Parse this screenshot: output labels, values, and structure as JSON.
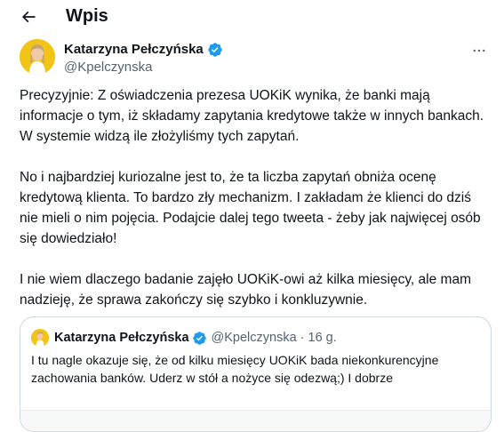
{
  "header": {
    "title": "Wpis"
  },
  "tweet": {
    "author_name": "Katarzyna Pełczyńska",
    "handle": "@Kpelczynska",
    "paragraphs": [
      "Precyzyjnie: Z oświadczenia prezesa UOKiK wynika, że banki mają informacje o tym, iż składamy zapytania kredytowe także w innych bankach. W systemie widzą ile złożyliśmy tych zapytań.",
      "No i najbardziej kuriozalne jest to, że ta liczba zapytań obniża ocenę kredytową klienta. To bardzo zły mechanizm.  I zakładam że klienci do dziś nie mieli o nim pojęcia. Podajcie dalej tego tweeta - żeby jak najwięcej osób się dowiedziało!",
      "I nie wiem dlaczego badanie zajęło UOKiK-owi aż kilka miesięcy, ale mam nadzieję, że sprawa zakończy się szybko i konkluzywnie."
    ]
  },
  "quote": {
    "author_name": "Katarzyna Pełczyńska",
    "handle": "@Kpelczynska",
    "separator": "·",
    "time": "16 g.",
    "text": "I tu nagle okazuje się, że od kilku miesięcy UOKiK bada niekonkurencyjne zachowania banków. Uderz w stół a nożyce się odezwą;) I dobrze"
  },
  "icons": {
    "back": "arrow-left-icon",
    "verified": "verified-badge-icon",
    "more": "more-horizontal-icon"
  },
  "colors": {
    "verified": "#1d9bf0",
    "secondary_text": "#536471",
    "border": "#cfd9de",
    "avatar_bg": "#f3c418"
  }
}
